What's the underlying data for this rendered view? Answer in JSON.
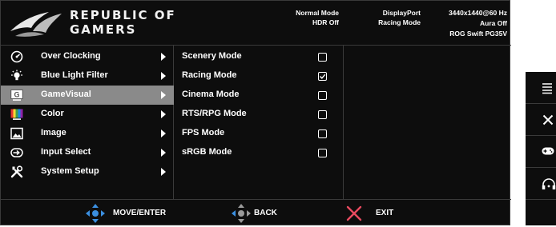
{
  "header": {
    "brand_line1": "REPUBLIC OF",
    "brand_line2": "GAMERS",
    "status_col1": [
      "Normal Mode",
      "HDR Off"
    ],
    "status_col2": [
      "DisplayPort",
      "Racing Mode"
    ],
    "status_col3": [
      "3440x1440@60 Hz",
      "Aura Off",
      "ROG Swift PG35V"
    ]
  },
  "main_menu": [
    {
      "label": "Over Clocking",
      "icon": "speedometer-icon"
    },
    {
      "label": "Blue Light Filter",
      "icon": "bulb-icon"
    },
    {
      "label": "GameVisual",
      "icon": "gamevisual-icon",
      "selected": true
    },
    {
      "label": "Color",
      "icon": "color-bars-icon"
    },
    {
      "label": "Image",
      "icon": "image-icon"
    },
    {
      "label": "Input Select",
      "icon": "input-select-icon"
    },
    {
      "label": "System Setup",
      "icon": "wrench-tools-icon"
    }
  ],
  "submenu": [
    {
      "label": "Scenery Mode",
      "checked": false
    },
    {
      "label": "Racing Mode",
      "checked": true
    },
    {
      "label": "Cinema Mode",
      "checked": false
    },
    {
      "label": "RTS/RPG Mode",
      "checked": false
    },
    {
      "label": "FPS Mode",
      "checked": false
    },
    {
      "label": "sRGB Mode",
      "checked": false
    }
  ],
  "footer": {
    "move_enter": "MOVE/ENTER",
    "back": "BACK",
    "exit": "EXIT"
  },
  "side_buttons": [
    "menu-icon",
    "close-icon",
    "gamepad-icon",
    "gamer-icon"
  ],
  "colors": {
    "background": "#0d0d0d",
    "selected_row": "#8a8a8a",
    "joystick_blue": "#3b8fe0",
    "exit_red": "#e84a5f"
  },
  "gamevisual_icon_letter": "G"
}
